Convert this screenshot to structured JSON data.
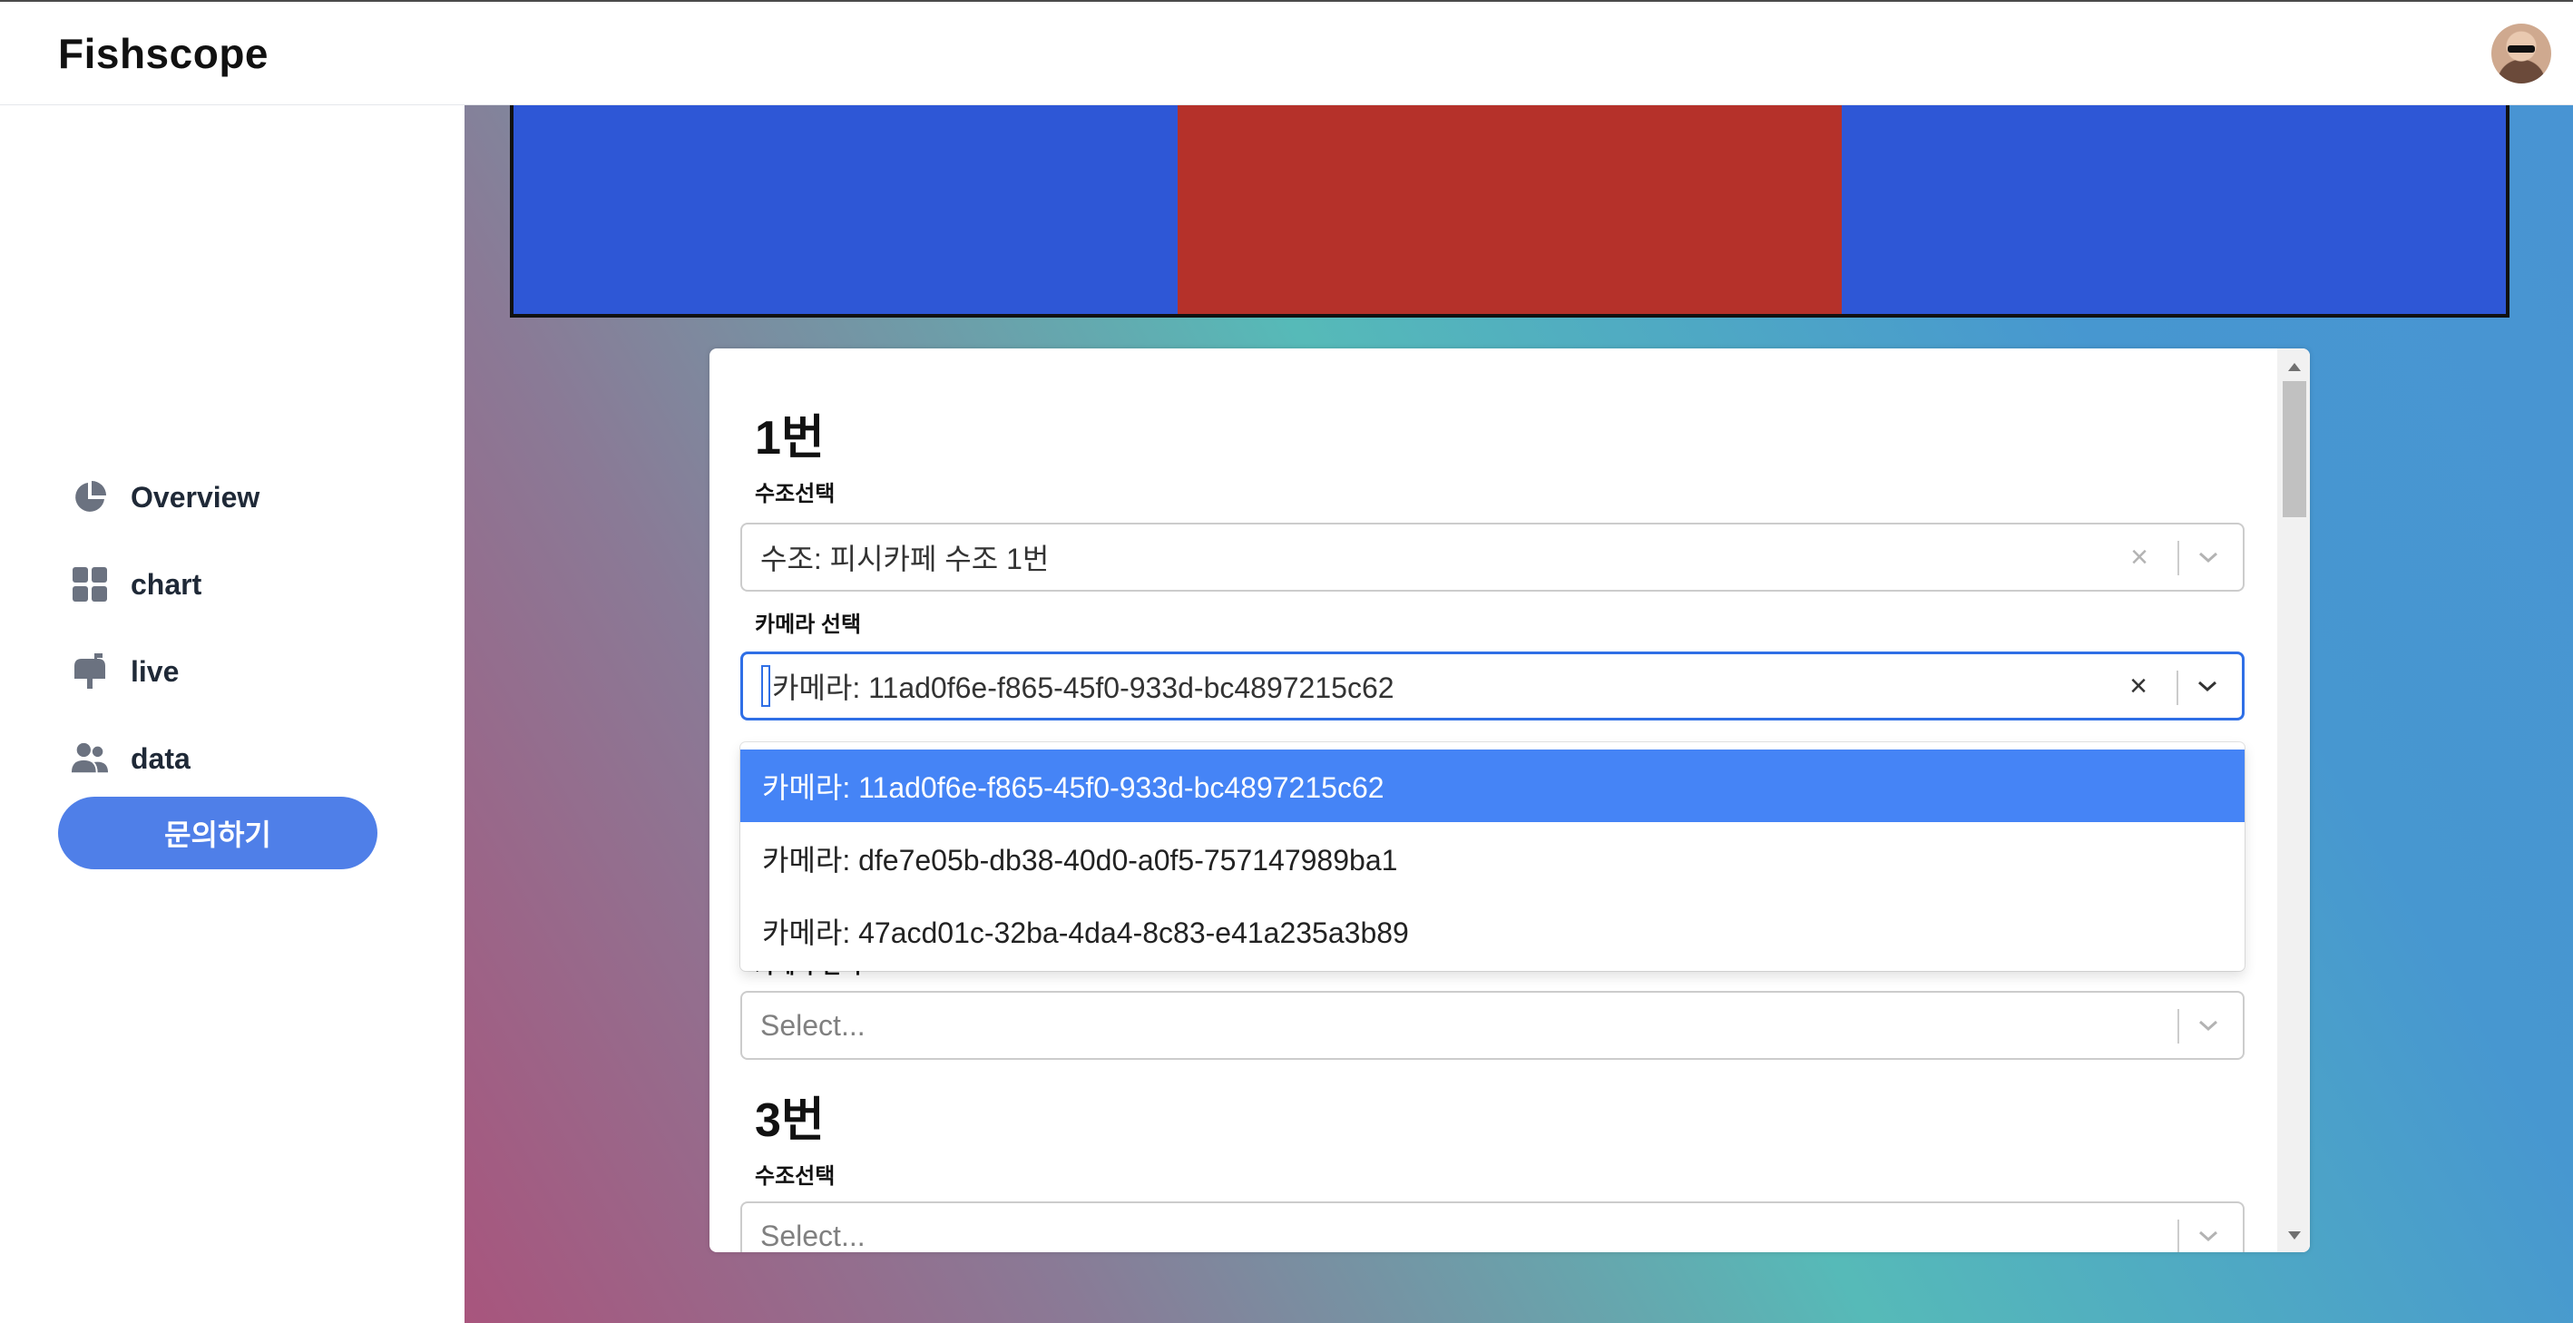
{
  "app": {
    "title": "Fishscope"
  },
  "header": {
    "avatar_icon": "user-avatar"
  },
  "sidebar": {
    "items": [
      {
        "label": "Overview",
        "icon": "pie-chart-icon"
      },
      {
        "label": "chart",
        "icon": "grid-icon"
      },
      {
        "label": "live",
        "icon": "mailbox-icon"
      },
      {
        "label": "data",
        "icon": "users-icon"
      }
    ],
    "cta_label": "문의하기"
  },
  "banner": {
    "colors": [
      "#2e57d6",
      "#b5312a",
      "#2e57d6"
    ]
  },
  "panel": {
    "sections": [
      {
        "heading": "1번",
        "tank_label": "수조선택",
        "tank_value": "수조: 피시카페 수조 1번",
        "camera_label": "카메라 선택",
        "camera_value": "카메라: 11ad0f6e-f865-45f0-933d-bc4897215c62"
      },
      {
        "camera_label": "카메라 선택",
        "camera_placeholder": "Select..."
      },
      {
        "heading": "3번",
        "tank_label": "수조선택",
        "tank_placeholder": "Select..."
      }
    ],
    "dropdown_options": [
      "카메라: 11ad0f6e-f865-45f0-933d-bc4897215c62",
      "카메라: dfe7e05b-db38-40d0-a0f5-757147989ba1",
      "카메라: 47acd01c-32ba-4da4-8c83-e41a235a3b89"
    ],
    "clear_symbol": "×"
  },
  "colors": {
    "accent": "#4f7fe8",
    "option_active": "#4584f6",
    "focus_border": "#2f6fe6"
  }
}
